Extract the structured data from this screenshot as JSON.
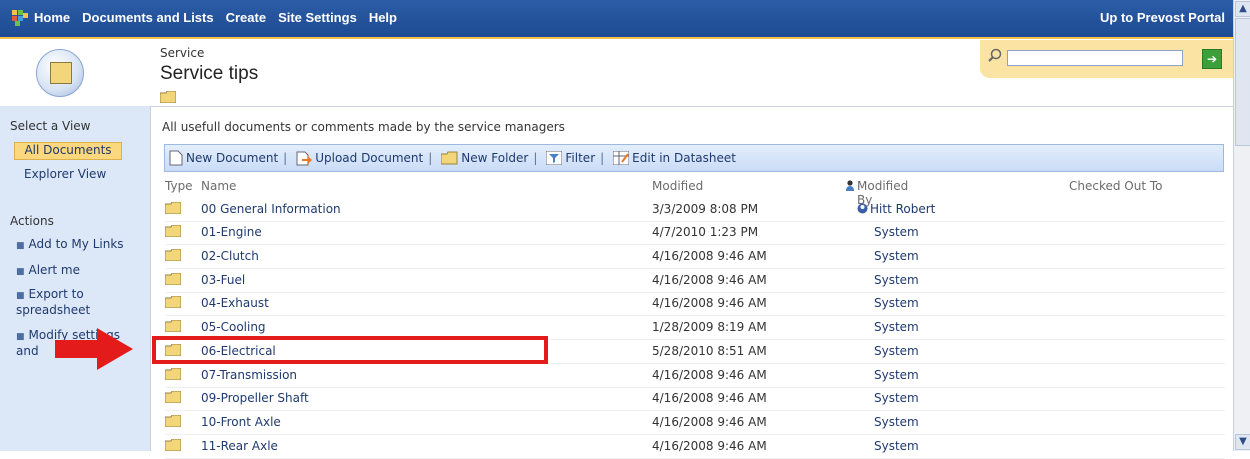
{
  "topbar": {
    "nav": [
      "Home",
      "Documents and Lists",
      "Create",
      "Site Settings",
      "Help"
    ],
    "portal_link": "Up to Prevost Portal"
  },
  "title_area": {
    "breadcrumb": "Service",
    "page_title": "Service tips"
  },
  "search": {
    "value": "",
    "go_glyph": "➔"
  },
  "leftnav": {
    "select_view_heading": "Select a View",
    "views": [
      "All Documents",
      "Explorer View"
    ],
    "actions_heading": "Actions",
    "actions": [
      {
        "label_lines": [
          "Add to My Links"
        ]
      },
      {
        "label_lines": [
          "Alert me"
        ]
      },
      {
        "label_lines": [
          "Export to",
          "spreadsheet"
        ]
      },
      {
        "label_lines": [
          "Modify settings",
          "and"
        ]
      }
    ]
  },
  "description": "All usefull documents or comments made by the service managers",
  "toolbar": {
    "new_document": "New Document",
    "upload_document": "Upload Document",
    "new_folder": "New Folder",
    "filter": "Filter",
    "edit_datasheet": "Edit in Datasheet",
    "separator": "|"
  },
  "columns": {
    "type": "Type",
    "name": "Name",
    "modified": "Modified",
    "modified_by": "Modified By",
    "checked_out_to": "Checked Out To"
  },
  "rows": [
    {
      "name": "00 General Information",
      "modified": "3/3/2009 8:08 PM",
      "modified_by": "Hitt Robert"
    },
    {
      "name": "01-Engine",
      "modified": "4/7/2010 1:23 PM",
      "modified_by": "System"
    },
    {
      "name": "02-Clutch",
      "modified": "4/16/2008 9:46 AM",
      "modified_by": "System"
    },
    {
      "name": "03-Fuel",
      "modified": "4/16/2008 9:46 AM",
      "modified_by": "System"
    },
    {
      "name": "04-Exhaust",
      "modified": "4/16/2008 9:46 AM",
      "modified_by": "System"
    },
    {
      "name": "05-Cooling",
      "modified": "1/28/2009 8:19 AM",
      "modified_by": "System"
    },
    {
      "name": "06-Electrical",
      "modified": "5/28/2010 8:51 AM",
      "modified_by": "System"
    },
    {
      "name": "07-Transmission",
      "modified": "4/16/2008 9:46 AM",
      "modified_by": "System"
    },
    {
      "name": "09-Propeller Shaft",
      "modified": "4/16/2008 9:46 AM",
      "modified_by": "System"
    },
    {
      "name": "10-Front Axle",
      "modified": "4/16/2008 9:46 AM",
      "modified_by": "System"
    },
    {
      "name": "11-Rear Axle",
      "modified": "4/16/2008 9:46 AM",
      "modified_by": "System"
    }
  ],
  "colors": {
    "topbar": "#1d4a93",
    "leftnav": "#dce7f7",
    "highlight": "#e41b1b",
    "link": "#1f3a6e"
  }
}
